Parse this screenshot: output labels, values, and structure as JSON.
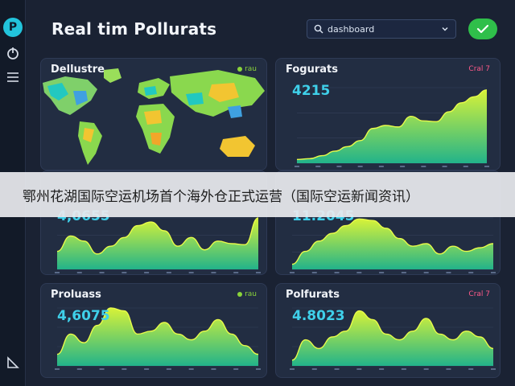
{
  "app": {
    "logo_letter": "P",
    "title": "Real tim Pollurats"
  },
  "search": {
    "value": "dashboard"
  },
  "cards": [
    {
      "title": "Dellustre",
      "tag": "rau",
      "tag_color": "#8ad43a"
    },
    {
      "title": "Fogurats",
      "tag": "Cral 7",
      "tag_color": "#ff5a8a",
      "value": "4215"
    },
    {
      "title": "",
      "tag": "",
      "tag_color": "#8ad43a",
      "value": "4,0655"
    },
    {
      "title": "",
      "tag": "",
      "tag_color": "#ff5a8a",
      "value": "11.2045"
    },
    {
      "title": "Proluass",
      "tag": "rau",
      "tag_color": "#8ad43a",
      "value": "4,6075"
    },
    {
      "title": "Polfurats",
      "tag": "Cral 7",
      "tag_color": "#ff5a8a",
      "value": "4.8023"
    }
  ],
  "banner": {
    "text": "鄂州花湖国际空运机场首个海外仓正式运营（国际空运新闻资讯）"
  },
  "icons": {
    "sidebar": [
      "power-icon",
      "menu-icon",
      "chart-corner-icon"
    ],
    "search": "search-icon",
    "confirm": "check-icon"
  },
  "colors": {
    "accent": "#22c4dc",
    "confirm": "#2fbf4a",
    "chart_top": "#d7f238",
    "chart_bottom": "#22b38a"
  }
}
